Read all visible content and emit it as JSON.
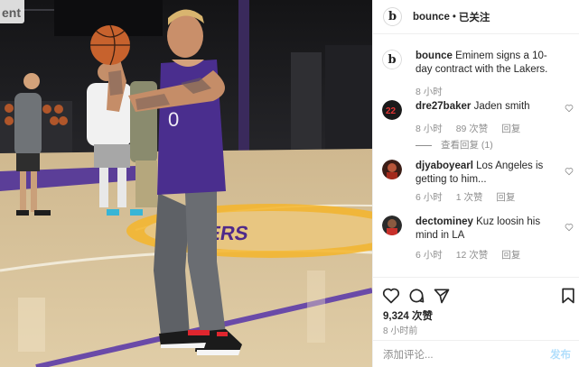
{
  "media": {
    "watermark": "ent",
    "jersey_number": "0",
    "court_text": "LAKERS"
  },
  "post": {
    "header": {
      "username": "bounce",
      "separator": "•",
      "follow_status": "已关注",
      "more_label": "•••"
    },
    "caption": {
      "username": "bounce",
      "text": "Eminem signs a 10-day contract with the Lakers.",
      "time": "8 小时"
    },
    "comments": [
      {
        "username": "dre27baker",
        "text": "Jaden smith",
        "time": "8 小时",
        "likes": "89 次赞",
        "reply_label": "回复",
        "view_replies": "查看回复 (1)",
        "avatar_text": "22"
      },
      {
        "username": "djyaboyearl",
        "text": "Los Angeles is getting to him...",
        "time": "6 小时",
        "likes": "1 次赞",
        "reply_label": "回复"
      },
      {
        "username": "dectominey",
        "text": "Kuz loosin his mind in LA",
        "time": "6 小时",
        "likes": "12 次赞",
        "reply_label": "回复"
      }
    ],
    "likes_count": "9,324 次赞",
    "posted_ago": "8 小时前",
    "comment_placeholder": "添加评论...",
    "post_button": "发布"
  },
  "colors": {
    "border": "#efefef",
    "muted": "#8e8e8e",
    "post_button_disabled": "#b2dffc",
    "lakers_purple": "#4f2a8a",
    "lakers_gold": "#f5b52a"
  },
  "icons": {
    "like": "heart-icon",
    "comment": "comment-bubble-icon",
    "share": "paper-plane-icon",
    "save": "bookmark-icon",
    "more": "ellipsis-icon"
  }
}
